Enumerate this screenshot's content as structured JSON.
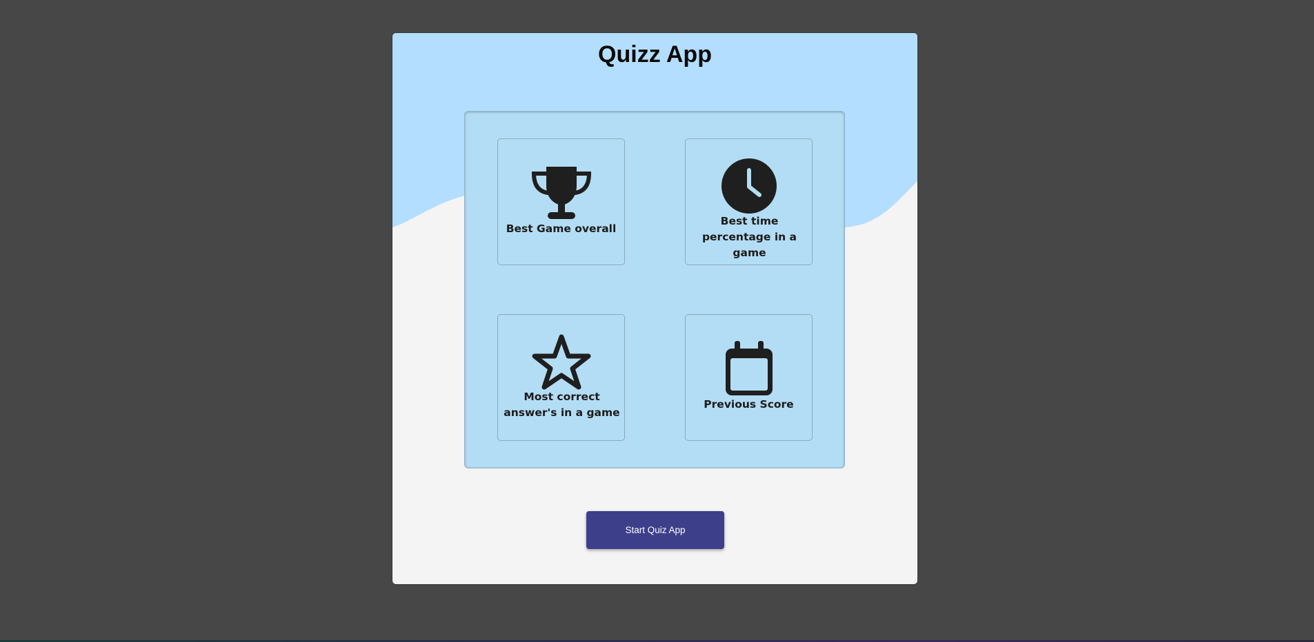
{
  "app": {
    "title": "Quizz App"
  },
  "tiles": [
    {
      "label": "Best Game overall",
      "icon": "trophy-icon"
    },
    {
      "label": "Best time percentage in a game",
      "icon": "clock-icon"
    },
    {
      "label": "Most correct answer's in a game",
      "icon": "star-icon"
    },
    {
      "label": "Previous Score",
      "icon": "calendar-icon"
    }
  ],
  "actions": {
    "start_label": "Start Quiz App"
  },
  "colors": {
    "page_background": "#474747",
    "header_wave": "#b3deff",
    "panel": "#b3ddf4",
    "card_background": "#f4f4f4",
    "button": "#3d3f8a",
    "icon": "#1f1f1f"
  }
}
